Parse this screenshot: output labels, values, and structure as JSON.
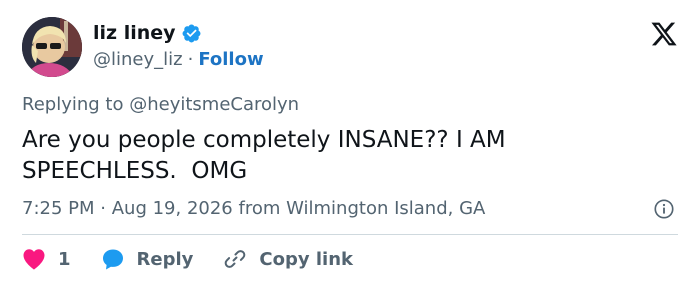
{
  "author": {
    "display_name": "liz liney",
    "handle": "@liney_liz",
    "separator": "·",
    "follow_label": "Follow",
    "verified_icon": "verified-badge-icon",
    "verified_color": "#1d9bf0"
  },
  "platform_logo": "x-logo-icon",
  "reply_context": {
    "prefix": "Replying to",
    "mention": "@heyitsmeCarolyn"
  },
  "tweet": {
    "text": "Are you people completely INSANE?? I AM SPEECHLESS.  OMG"
  },
  "meta": {
    "time": "7:25 PM",
    "separator": "·",
    "date": "Aug 19, 2026",
    "location": "from Wilmington Island, GA",
    "info_icon": "info-icon"
  },
  "actions": {
    "like_count": "1",
    "like_icon": "heart-icon",
    "like_color": "#f91880",
    "reply_label": "Reply",
    "reply_icon": "speech-bubble-icon",
    "reply_color": "#1d9bf0",
    "copy_label": "Copy link",
    "copy_icon": "link-icon"
  }
}
